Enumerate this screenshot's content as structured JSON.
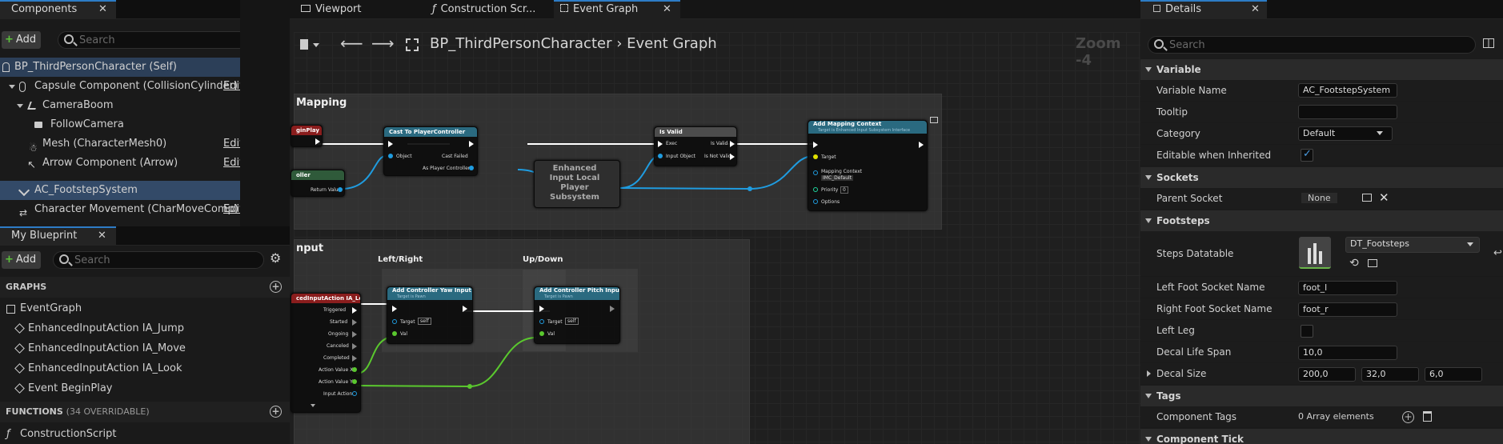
{
  "components_panel": {
    "tab_label": "Components",
    "add_label": "Add",
    "search_placeholder": "Search",
    "items": [
      {
        "label": "BP_ThirdPersonCharacter (Self)",
        "edit": ""
      },
      {
        "label": "Capsule Component (CollisionCylinder)",
        "edit": "Edit in C++"
      },
      {
        "label": "CameraBoom",
        "edit": ""
      },
      {
        "label": "FollowCamera",
        "edit": ""
      },
      {
        "label": "Mesh (CharacterMesh0)",
        "edit": "Edit in C++"
      },
      {
        "label": "Arrow Component (Arrow)",
        "edit": "Edit in C++"
      },
      {
        "label": "AC_FootstepSystem",
        "edit": ""
      },
      {
        "label": "Character Movement (CharMoveComp)",
        "edit": "Edit in C++"
      }
    ]
  },
  "blueprint_panel": {
    "tab_label": "My Blueprint",
    "add_label": "Add",
    "search_placeholder": "Search",
    "graphs_header": "GRAPHS",
    "graphs": [
      "EventGraph",
      "EnhancedInputAction IA_Jump",
      "EnhancedInputAction IA_Move",
      "EnhancedInputAction IA_Look",
      "Event BeginPlay"
    ],
    "functions_header": "FUNCTIONS",
    "functions_note": "(34 OVERRIDABLE)",
    "functions": [
      "ConstructionScript"
    ]
  },
  "editor_tabs": [
    "Viewport",
    "Construction Scr...",
    "Event Graph"
  ],
  "graph": {
    "breadcrumb_blueprint": "BP_ThirdPersonCharacter",
    "breadcrumb_graph": "Event Graph",
    "zoom": "Zoom -4",
    "comment_mapping": "Mapping",
    "comment_input": "nput",
    "label_left_right": "Left/Right",
    "label_up_down": "Up/Down",
    "nodes": {
      "begin_play": "ginPlay",
      "get_controller": "oller",
      "return_value": "Return Value",
      "cast": "Cast To PlayerController",
      "cast_object": "Object",
      "cast_failed": "Cast Failed",
      "as_player_controller": "As Player Controller",
      "subsystem": "Enhanced Input Local Player Subsystem",
      "is_valid": "Is Valid",
      "exec": "Exec",
      "is_valid_out": "Is Valid",
      "input_object": "Input Object",
      "is_not_valid": "Is Not Valid",
      "add_mapping": "Add Mapping Context",
      "add_mapping_sub": "Target is Enhanced Input Subsystem Interface",
      "target": "Target",
      "mapping_context": "Mapping Context",
      "imc_default": "IMC_Default",
      "priority": "Priority",
      "priority_value": "0",
      "options": "Options",
      "ia_look": "cedInputAction IA_Look",
      "triggered": "Triggered",
      "started": "Started",
      "ongoing": "Ongoing",
      "canceled": "Canceled",
      "completed": "Completed",
      "action_x": "Action Value X",
      "action_y": "Action Value Y",
      "input_action": "Input Action",
      "yaw": "Add Controller Yaw Input",
      "pitch": "Add Controller Pitch Input",
      "target_pawn": "Target is Pawn",
      "self": "self",
      "val": "Val"
    }
  },
  "details": {
    "tab_label": "Details",
    "search_placeholder": "Search",
    "sections": {
      "variable": "Variable",
      "sockets": "Sockets",
      "footsteps": "Footsteps",
      "tags": "Tags",
      "component_tick": "Component Tick"
    },
    "variable_name_label": "Variable Name",
    "variable_name": "AC_FootstepSystem",
    "tooltip_label": "Tooltip",
    "tooltip_value": "",
    "category_label": "Category",
    "category_value": "Default",
    "editable_label": "Editable when Inherited",
    "parent_socket_label": "Parent Socket",
    "parent_socket_value": "None",
    "steps_datatable_label": "Steps Datatable",
    "steps_datatable_value": "DT_Footsteps",
    "left_foot_label": "Left Foot Socket Name",
    "left_foot_value": "foot_l",
    "right_foot_label": "Right Foot Socket Name",
    "right_foot_value": "foot_r",
    "left_leg_label": "Left Leg",
    "decal_life_label": "Decal Life Span",
    "decal_life_value": "10,0",
    "decal_size_label": "Decal Size",
    "decal_size_x": "200,0",
    "decal_size_y": "32,0",
    "decal_size_z": "6,0",
    "component_tags_label": "Component Tags",
    "component_tags_value": "0 Array elements"
  },
  "colors": {
    "accent": "#2d7cc6",
    "object_pin": "#1f9ce0",
    "float_pin": "#5ac82e",
    "event_header": "#8a1d1d",
    "function_header": "#2a6a80"
  }
}
